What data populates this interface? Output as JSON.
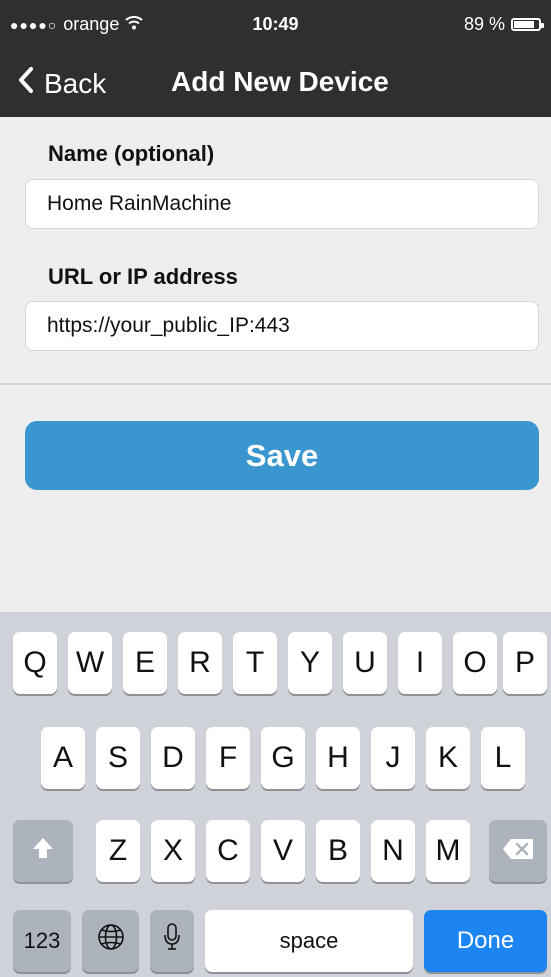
{
  "status_bar": {
    "signal_dots": "●●●●○",
    "carrier": "orange",
    "time": "10:49",
    "battery_percent": "89 %",
    "battery_level": 0.89
  },
  "navbar": {
    "back_label": "Back",
    "title": "Add New Device"
  },
  "form": {
    "name_label": "Name (optional)",
    "name_value": "Home RainMachine",
    "url_label": "URL or IP address",
    "url_value": "https://your_public_IP:443",
    "save_label": "Save"
  },
  "keyboard": {
    "row1": [
      "Q",
      "W",
      "E",
      "R",
      "T",
      "Y",
      "U",
      "I",
      "O",
      "P"
    ],
    "row2": [
      "A",
      "S",
      "D",
      "F",
      "G",
      "H",
      "J",
      "K",
      "L"
    ],
    "row3": [
      "Z",
      "X",
      "C",
      "V",
      "B",
      "N",
      "M"
    ],
    "numbers_label": "123",
    "space_label": "space",
    "done_label": "Done"
  },
  "colors": {
    "bar_bg": "#2f2f2f",
    "save_button": "#3a96cf",
    "done_key": "#1c85f2",
    "keyboard_bg": "#cfd3d9"
  }
}
